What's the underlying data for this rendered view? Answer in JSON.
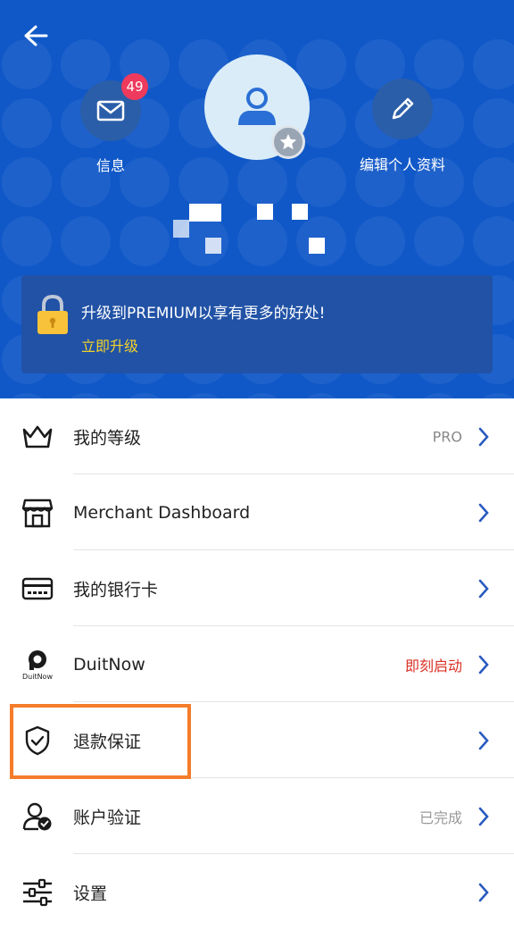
{
  "header": {
    "messages_label": "信息",
    "messages_badge": "49",
    "edit_profile_label": "编辑个人资料"
  },
  "premium": {
    "text": "升级到PREMIUM以享有更多的好处!",
    "link": "立即升级"
  },
  "menu": [
    {
      "icon": "crown-icon",
      "label": "我的等级",
      "value": "PRO",
      "value_color": "#888888"
    },
    {
      "icon": "store-icon",
      "label": "Merchant Dashboard",
      "value": "",
      "value_color": "#888888"
    },
    {
      "icon": "bank-card-icon",
      "label": "我的银行卡",
      "value": "",
      "value_color": "#888888"
    },
    {
      "icon": "duitnow-logo",
      "label": "DuitNow",
      "value": "即刻启动",
      "value_color": "#d93025"
    },
    {
      "icon": "shield-check-icon",
      "label": "退款保证",
      "value": "",
      "value_color": "#888888"
    },
    {
      "icon": "user-verify-icon",
      "label": "账户验证",
      "value": "已完成",
      "value_color": "#999999"
    },
    {
      "icon": "settings-sliders-icon",
      "label": "设置",
      "value": "",
      "value_color": "#888888"
    }
  ],
  "duitnow_logo_text": "DuitNow",
  "colors": {
    "header_bg": "#1058c8",
    "accent": "#2a5bbf",
    "upgrade_link": "#f3d22a",
    "badge": "#ee3a5c",
    "highlight": "#f47c2a"
  }
}
